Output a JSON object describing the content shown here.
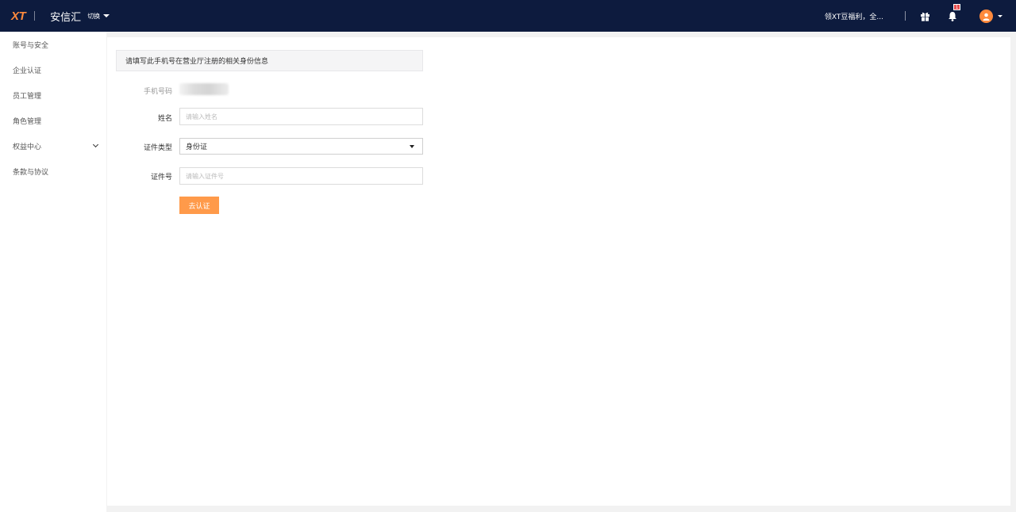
{
  "header": {
    "logo": "XT",
    "brand": "安信汇",
    "switch_label": "切换",
    "promo": "领XT豆福利，全...",
    "notification_count": "1"
  },
  "sidebar": {
    "items": [
      {
        "label": "账号与安全"
      },
      {
        "label": "企业认证"
      },
      {
        "label": "员工管理"
      },
      {
        "label": "角色管理"
      },
      {
        "label": "权益中心"
      },
      {
        "label": "条款与协议"
      }
    ]
  },
  "form": {
    "notice": "请填写此手机号在营业厅注册的相关身份信息",
    "phone_label": "手机号码",
    "name_label": "姓名",
    "name_placeholder": "请输入姓名",
    "id_type_label": "证件类型",
    "id_type_value": "身份证",
    "id_number_label": "证件号",
    "id_number_placeholder": "请输入证件号",
    "submit_label": "去认证"
  },
  "colors": {
    "topbar": "#0d1b3e",
    "accent": "#ff8a3d",
    "button": "#ff9a4a"
  }
}
